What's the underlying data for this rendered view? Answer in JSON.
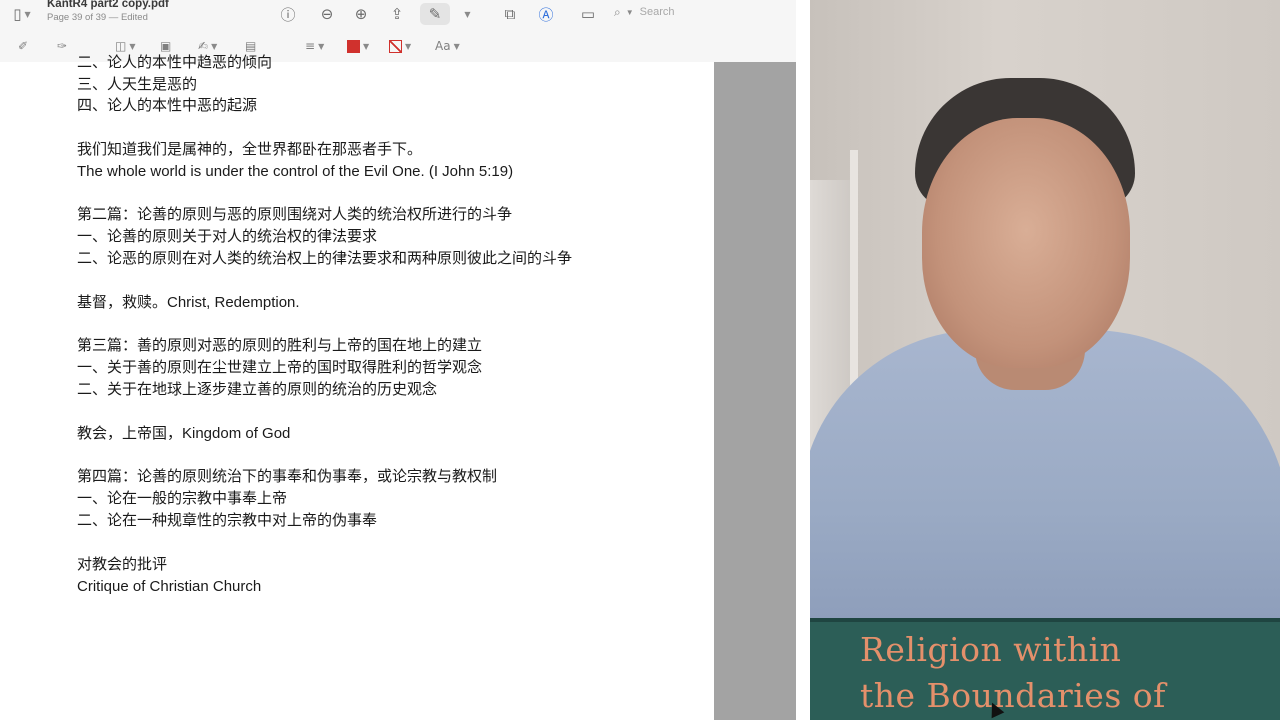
{
  "window": {
    "title": "KantR4 part2 copy.pdf",
    "subtitle": "Page 39 of 39 — Edited"
  },
  "toolbar": {
    "search_placeholder": "Search",
    "icons": [
      "sidebar-icon",
      "info-icon",
      "zoom-out-icon",
      "zoom-in-icon",
      "share-icon",
      "highlight-pen-icon",
      "rotate-icon",
      "markup-icon",
      "annotate-form-icon",
      "search-icon"
    ],
    "row2_icons": [
      "text-selection-icon",
      "sketch-icon",
      "shapes-icon",
      "text-box-icon",
      "signature-icon",
      "note-icon",
      "line-style-icon",
      "border-color-icon",
      "fill-color-icon",
      "text-style-icon"
    ],
    "text_style_label": "Aa",
    "border_color": "#d0312d",
    "fill_color": "#d0312d"
  },
  "document": {
    "lines": [
      "二、论人的本性中趋恶的倾向",
      "三、人天生是恶的",
      "四、论人的本性中恶的起源",
      "我们知道我们是属神的，全世界都卧在那恶者手下。",
      "The whole world is under the control of the Evil One. (I John 5:19)",
      "第二篇：论善的原则与恶的原则围绕对人类的统治权所进行的斗争",
      "一、论善的原则关于对人的统治权的律法要求",
      "二、论恶的原则在对人类的统治权上的律法要求和两种原则彼此之间的斗争",
      "基督，救赎。Christ, Redemption.",
      "第三篇：善的原则对恶的原则的胜利与上帝的国在地上的建立",
      "一、关于善的原则在尘世建立上帝的国时取得胜利的哲学观念",
      "二、关于在地球上逐步建立善的原则的统治的历史观念",
      "教会，上帝国，Kingdom of God",
      "第四篇：论善的原则统治下的事奉和伪事奉，或论宗教与教权制",
      "一、论在一般的宗教中事奉上帝",
      "二、论在一种规章性的宗教中对上帝的伪事奉",
      "对教会的批评",
      "Critique of Christian Church"
    ]
  },
  "webcam": {
    "book_title_line1": "Religion within",
    "book_title_line2": "the Boundaries of",
    "book_cover_color": "#2c5e57",
    "book_text_color": "#e4906b"
  }
}
